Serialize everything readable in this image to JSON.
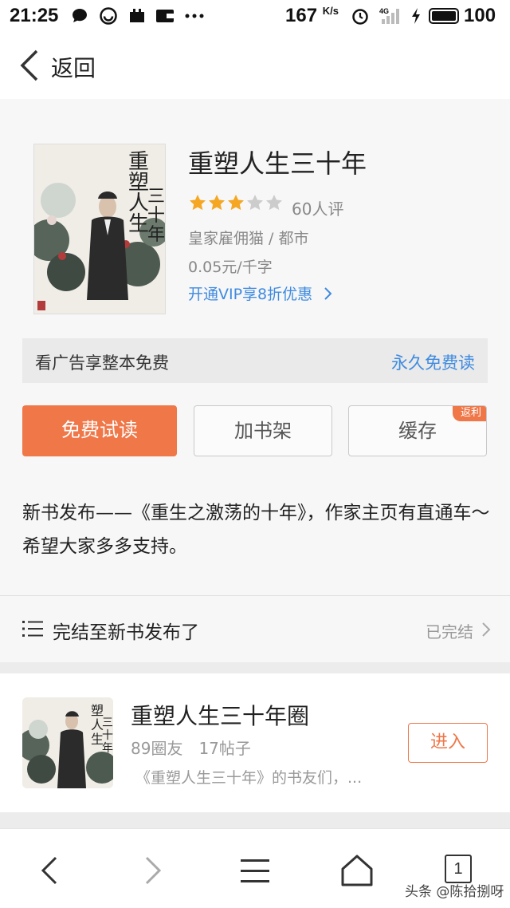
{
  "status_bar": {
    "time": "21:25",
    "net_speed": "167",
    "net_unit": "K/s",
    "network_type": "4G",
    "battery": "100",
    "icons": [
      "chat-bubble-icon",
      "browser-icon",
      "app-icon",
      "wallet-icon",
      "more-dots-icon",
      "alarm-icon",
      "signal-icon",
      "charging-icon",
      "battery-icon"
    ]
  },
  "header": {
    "back_label": "返回"
  },
  "book": {
    "title": "重塑人生三十年",
    "rating_stars": 3,
    "rating_max": 5,
    "rating_count": "60人评",
    "author_genre": "皇家雇佣猫 / 都市",
    "price": "0.05元/千字",
    "vip_offer": "开通VIP享8折优惠"
  },
  "ad_bar": {
    "text": "看广告享整本免费",
    "link": "永久免费读"
  },
  "actions": {
    "read_label": "免费试读",
    "shelf_label": "加书架",
    "cache_label": "缓存",
    "cache_badge": "返利"
  },
  "description": "新书发布——《重生之激荡的十年》，作家主页有直通车～希望大家多多支持。",
  "catalog": {
    "label": "完结至新书发布了",
    "status": "已完结"
  },
  "circle": {
    "title": "重塑人生三十年圈",
    "members": "89圈友",
    "posts": "17帖子",
    "description": "《重塑人生三十年》的书友们，...",
    "enter_label": "进入"
  },
  "bottom_nav": {
    "tab_count": "1",
    "watermark": "头条 @陈拾捌呀"
  },
  "colors": {
    "accent": "#ef7748",
    "link": "#3f8be0",
    "star_on": "#f5a623",
    "star_off": "#cccccc"
  }
}
